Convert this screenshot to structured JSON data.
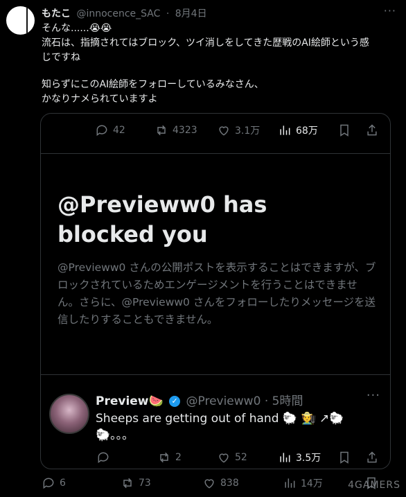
{
  "tweet": {
    "author_name": "もたこ",
    "author_handle": "@innocence_SAC",
    "time": "8月4日",
    "lines": [
      "そんな......😭😭",
      "流石は、指摘されてはブロック、ツイ消しをしてきた歴戦のAI絵師という感",
      "じですね",
      "",
      "知らずにこのAI絵師をフォローしているみなさん、",
      "かなりナメられていますよ"
    ]
  },
  "card": {
    "top_actions": {
      "replies": "42",
      "reposts": "4323",
      "likes": "3.1万",
      "views": "68万"
    },
    "blocked": {
      "title_line1": "@Previeww0 has",
      "title_line2": "blocked you",
      "description": "@Previeww0 さんの公開ポストを表示することはできますが、ブロックされているためエンゲージメントを行うことはできません。さらに、@Previeww0 さんをフォローしたりメッセージを送信したりすることもできません。"
    },
    "quoted": {
      "name": "Preview🍉",
      "handle": "@Previeww0",
      "time": "5時間",
      "text": "Sheeps are getting out of hand 🐑 🧑‍🌾 ↗🐑 🐑。。。",
      "replies": "",
      "reposts": "2",
      "likes": "52",
      "views": "3.5万"
    }
  },
  "bottom_actions": {
    "replies": "6",
    "reposts": "73",
    "likes": "838",
    "views": "14万"
  },
  "watermark": "4GAMERS",
  "colors": {
    "background": "#000000",
    "text": "#e7e9ea",
    "muted": "#71767b",
    "border": "#2f3336",
    "verified": "#1d9bf0"
  }
}
